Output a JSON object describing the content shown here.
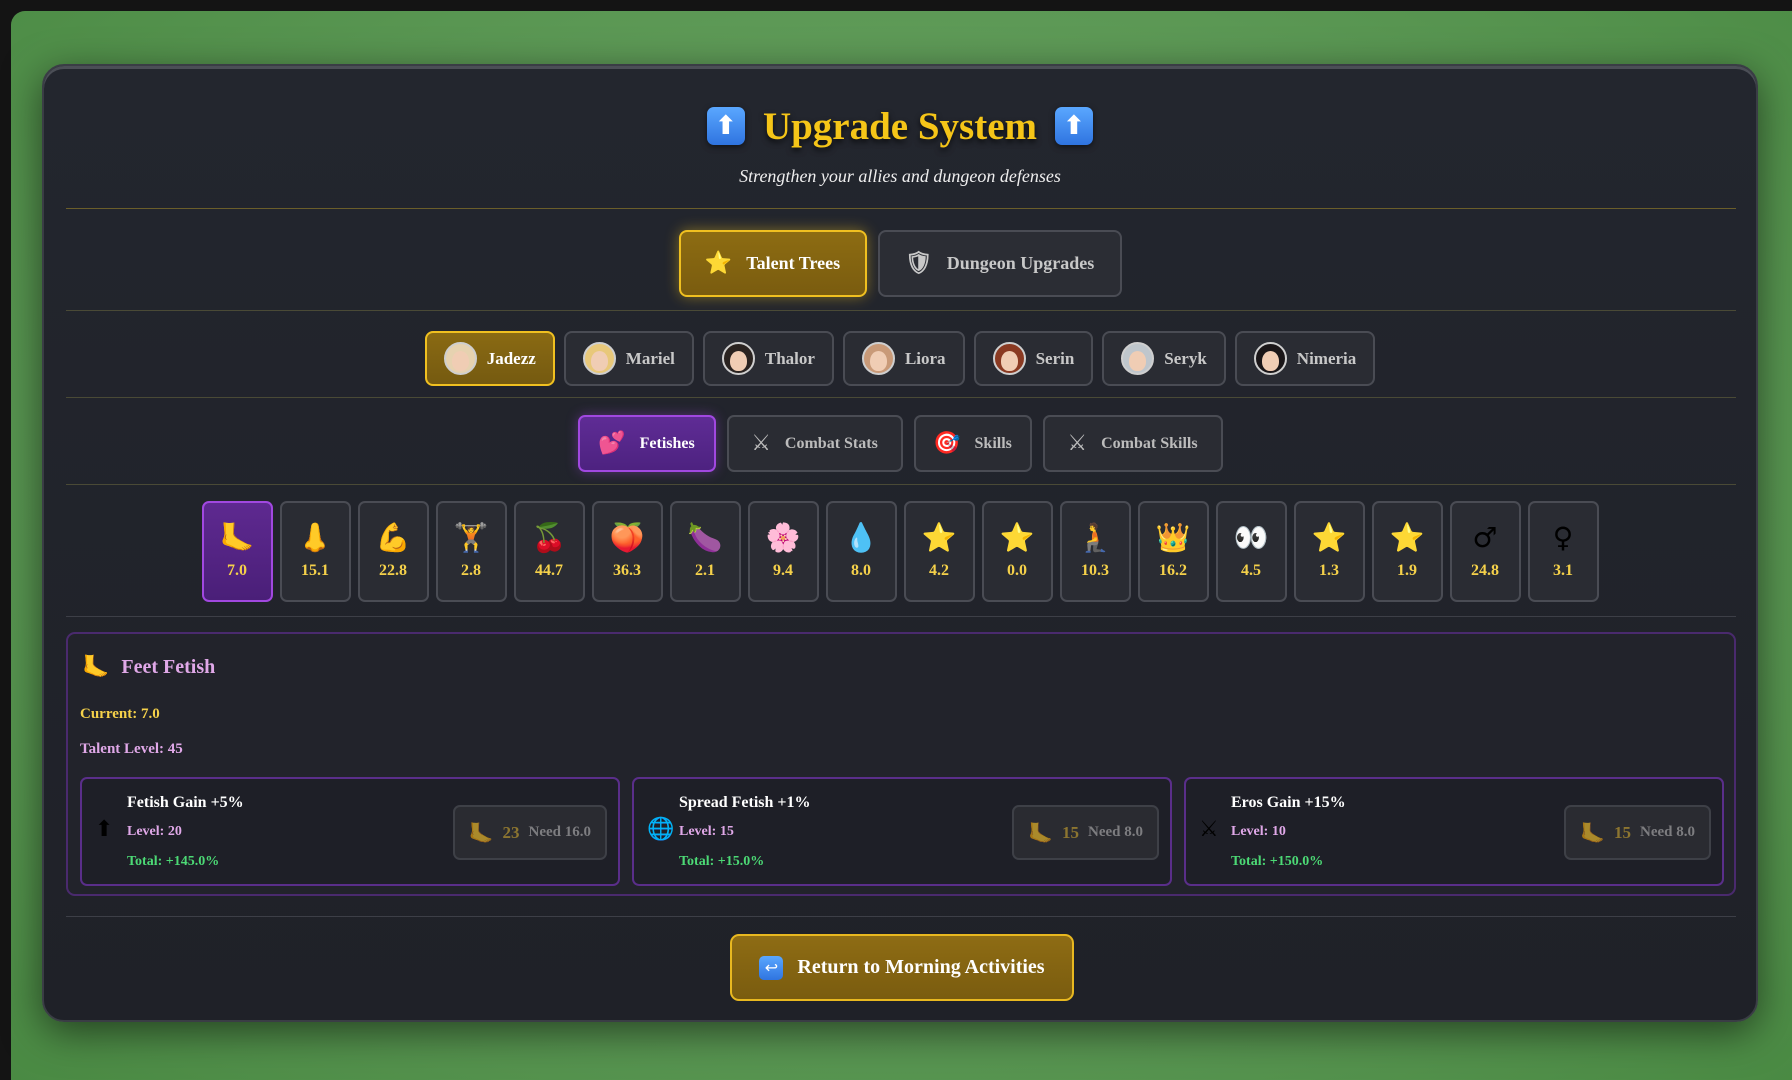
{
  "header": {
    "title": "Upgrade System",
    "title_icon": "up-arrow-icon",
    "subtitle": "Strengthen your allies and dungeon defenses"
  },
  "main_tabs": [
    {
      "label": "Talent Trees",
      "icon": "star-icon",
      "glyph": "⭐",
      "active": true
    },
    {
      "label": "Dungeon Upgrades",
      "icon": "shield-icon",
      "glyph": "🛡",
      "active": false
    }
  ],
  "characters": [
    {
      "name": "Jadezz",
      "active": true,
      "hair": "#e6d2b0"
    },
    {
      "name": "Mariel",
      "active": false,
      "hair": "#e8c87a"
    },
    {
      "name": "Thalor",
      "active": false,
      "hair": "#2a2320"
    },
    {
      "name": "Liora",
      "active": false,
      "hair": "#c99a78"
    },
    {
      "name": "Serin",
      "active": false,
      "hair": "#8a3a22"
    },
    {
      "name": "Seryk",
      "active": false,
      "hair": "#bfc6cc"
    },
    {
      "name": "Nimeria",
      "active": false,
      "hair": "#1a1618"
    }
  ],
  "sub_tabs": [
    {
      "label": "Fetishes",
      "icon": "hearts-icon",
      "glyph": "💕",
      "active": true
    },
    {
      "label": "Combat Stats",
      "icon": "crossed-swords-icon",
      "glyph": "⚔",
      "active": false
    },
    {
      "label": "Skills",
      "icon": "target-icon",
      "glyph": "🎯",
      "active": false
    },
    {
      "label": "Combat Skills",
      "icon": "crossed-swords-icon",
      "glyph": "⚔",
      "active": false
    }
  ],
  "fetishes": [
    {
      "icon": "foot-icon",
      "glyph": "🦶",
      "value": "7.0",
      "active": true
    },
    {
      "icon": "nose-icon",
      "glyph": "👃",
      "value": "15.1"
    },
    {
      "icon": "flexed-biceps-icon",
      "glyph": "💪",
      "value": "22.8"
    },
    {
      "icon": "weightlifter-icon",
      "glyph": "🏋",
      "value": "2.8"
    },
    {
      "icon": "cherries-icon",
      "glyph": "🍒",
      "value": "44.7"
    },
    {
      "icon": "peach-icon",
      "glyph": "🍑",
      "value": "36.3"
    },
    {
      "icon": "eggplant-icon",
      "glyph": "🍆",
      "value": "2.1"
    },
    {
      "icon": "flower-icon",
      "glyph": "🌸",
      "value": "9.4"
    },
    {
      "icon": "droplet-icon",
      "glyph": "💧",
      "value": "8.0"
    },
    {
      "icon": "star-icon",
      "glyph": "⭐",
      "value": "4.2"
    },
    {
      "icon": "star-icon",
      "glyph": "⭐",
      "value": "0.0"
    },
    {
      "icon": "kneel-icon",
      "glyph": "🧎",
      "value": "10.3"
    },
    {
      "icon": "crown-icon",
      "glyph": "👑",
      "value": "16.2"
    },
    {
      "icon": "eyes-icon",
      "glyph": "👀",
      "value": "4.5"
    },
    {
      "icon": "star-icon",
      "glyph": "⭐",
      "value": "1.3"
    },
    {
      "icon": "star-icon",
      "glyph": "⭐",
      "value": "1.9"
    },
    {
      "icon": "male-sign-icon",
      "glyph": "♂",
      "value": "24.8"
    },
    {
      "icon": "female-sign-icon",
      "glyph": "♀",
      "value": "3.1"
    }
  ],
  "detail": {
    "icon": "foot-icon",
    "glyph": "🦶",
    "title": "Feet Fetish",
    "current": "Current: 7.0",
    "talent_level": "Talent Level: 45"
  },
  "upgrades": [
    {
      "name": "Fetish Gain +5%",
      "icon": "up-arrow-icon",
      "glyph": "⬆",
      "level": "Level: 20",
      "total": "Total: +145.0%",
      "cost": "23",
      "need": "Need 16.0"
    },
    {
      "name": "Spread Fetish +1%",
      "icon": "globe-icon",
      "glyph": "🌐",
      "level": "Level: 15",
      "total": "Total: +15.0%",
      "cost": "15",
      "need": "Need 8.0"
    },
    {
      "name": "Eros Gain +15%",
      "icon": "crossed-swords-icon",
      "glyph": "⚔",
      "level": "Level: 10",
      "total": "Total: +150.0%",
      "cost": "15",
      "need": "Need 8.0"
    }
  ],
  "footer": {
    "return_label": "Return to Morning Activities",
    "return_icon": "return-arrow-icon"
  }
}
